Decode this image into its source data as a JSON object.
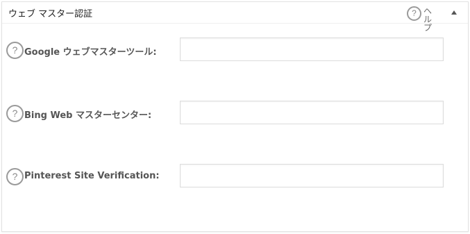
{
  "panel": {
    "title": "ウェブ マスター認証",
    "help_label": "ヘルプ",
    "help_icon_glyph": "?"
  },
  "fields": [
    {
      "label": "Google ウェブマスターツール:",
      "value": "",
      "help_glyph": "?"
    },
    {
      "label": "Bing Web マスターセンター:",
      "value": "",
      "help_glyph": "?"
    },
    {
      "label": "Pinterest Site Verification:",
      "value": "",
      "help_glyph": "?"
    }
  ],
  "icons": {
    "help": "question-circle-icon",
    "toggle": "triangle-up-icon"
  }
}
